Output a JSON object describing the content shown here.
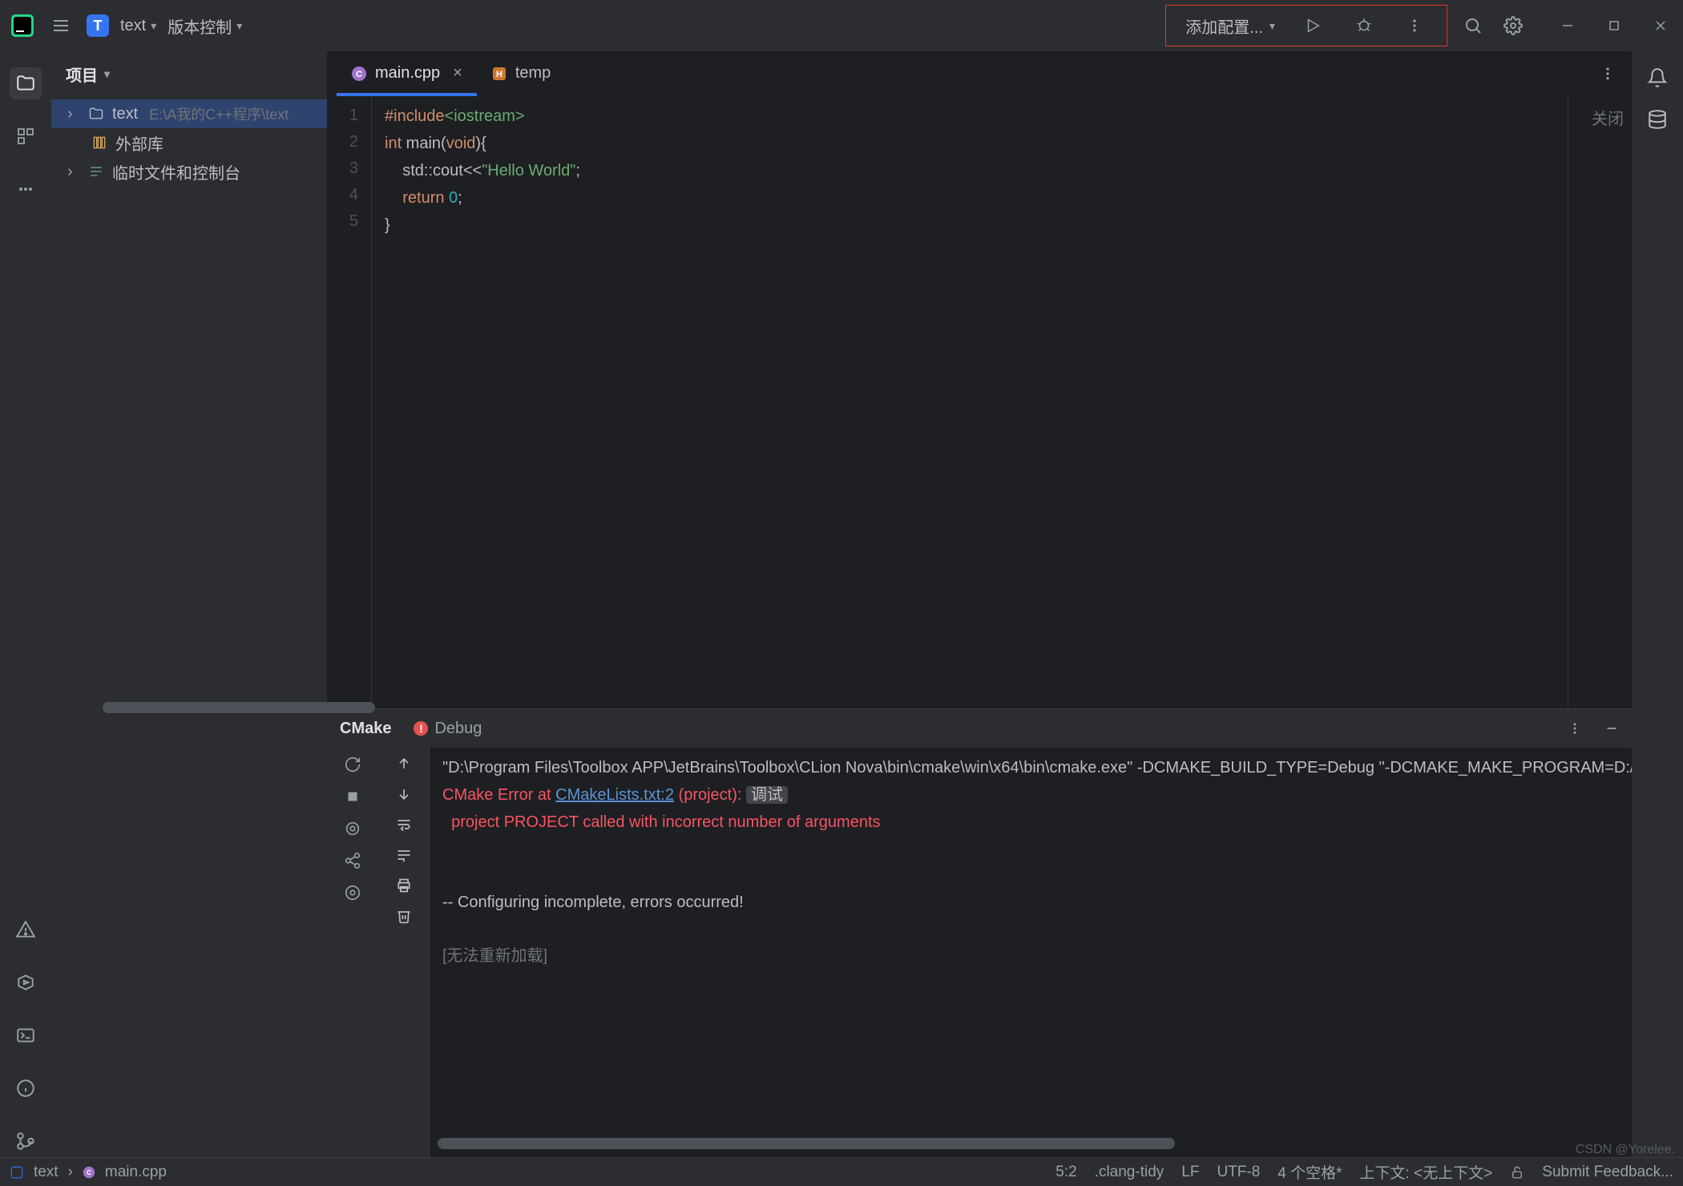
{
  "titlebar": {
    "project_badge": "T",
    "project_name": "text",
    "vcs_label": "版本控制",
    "run_config": "添加配置..."
  },
  "sidebar": {
    "header": "项目",
    "tree": {
      "root_name": "text",
      "root_path": "E:\\A我的C++程序\\text",
      "ext_lib": "外部库",
      "scratch": "临时文件和控制台"
    }
  },
  "tabs": {
    "t1": "main.cpp",
    "t2": "temp"
  },
  "editor_aux": {
    "close": "关闭"
  },
  "code_lines": {
    "l1": {
      "pp": "#include",
      "inc": "<iostream>"
    },
    "l2": {
      "kw_int": "int",
      "main": " main(",
      "kw_void": "void",
      "rest": "){"
    },
    "l3": {
      "indent": "    std::cout<<",
      "str": "\"Hello World\"",
      "semi": ";"
    },
    "l4": {
      "indent": "    ",
      "kw_return": "return",
      "sp": " ",
      "num": "0",
      "semi": ";"
    },
    "l5": {
      "brace": "}"
    }
  },
  "gutter": {
    "n1": "1",
    "n2": "2",
    "n3": "3",
    "n4": "4",
    "n5": "5"
  },
  "tool": {
    "tab_cmake": "CMake",
    "tab_debug": "Debug",
    "line1": "\"D:\\Program Files\\Toolbox APP\\JetBrains\\Toolbox\\CLion Nova\\bin\\cmake\\win\\x64\\bin\\cmake.exe\" -DCMAKE_BUILD_TYPE=Debug \"-DCMAKE_MAKE_PROGRAM=D:/Program Fi",
    "err_prefix": "CMake Error at ",
    "err_link": "CMakeLists.txt:2",
    "err_suffix": " (project): ",
    "err_badge": "调试",
    "err_msg": "  project PROJECT called with incorrect number of arguments",
    "config_incomplete": "-- Configuring incomplete, errors occurred!",
    "reload_fail": "[无法重新加载]"
  },
  "statusbar": {
    "crumb1": "text",
    "crumb2": "main.cpp",
    "pos": "5:2",
    "clang": ".clang-tidy",
    "lf": "LF",
    "enc": "UTF-8",
    "indent": "4 个空格*",
    "ctx": "上下文: <无上下文>",
    "feedback": "Submit Feedback..."
  },
  "watermark": "CSDN @Yorelee."
}
